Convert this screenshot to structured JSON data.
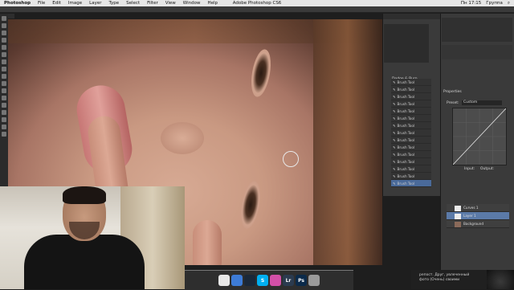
{
  "menubar": {
    "app_name": "Photoshop",
    "items": [
      "File",
      "Edit",
      "Image",
      "Layer",
      "Type",
      "Select",
      "Filter",
      "View",
      "Window",
      "Help"
    ],
    "clock": "Пн 17:15",
    "user": "Группа"
  },
  "window": {
    "title": "Adobe Photoshop CS6"
  },
  "layers_panel": {
    "group_label": "Dodge & Burn",
    "rows": [
      "Brush Tool",
      "Brush Tool",
      "Brush Tool",
      "Brush Tool",
      "Brush Tool",
      "Brush Tool",
      "Brush Tool",
      "Brush Tool",
      "Brush Tool",
      "Brush Tool",
      "Brush Tool",
      "Brush Tool",
      "Brush Tool",
      "Brush Tool",
      "Brush Tool"
    ]
  },
  "properties_panel": {
    "title": "Properties",
    "preset_label": "Preset:",
    "preset_value": "Custom",
    "channel_value": "RGB",
    "auto_label": "Auto",
    "input_label": "Input:",
    "output_label": "Output:"
  },
  "layers_right": {
    "rows": [
      "Curves 1",
      "Layer 1",
      "Background"
    ]
  },
  "dock": {
    "icons": [
      {
        "name": "chrome-icon",
        "label": "",
        "color": "#e8e8e8"
      },
      {
        "name": "finder-icon",
        "label": "",
        "color": "#3d7bd6"
      },
      {
        "name": "steam-icon",
        "label": "",
        "color": "#1b2838"
      },
      {
        "name": "skype-icon",
        "label": "S",
        "color": "#00aff0"
      },
      {
        "name": "itunes-icon",
        "label": "",
        "color": "#d24fa7"
      },
      {
        "name": "lightroom-icon",
        "label": "Lr",
        "color": "#2b3b4f"
      },
      {
        "name": "photoshop-icon",
        "label": "Ps",
        "color": "#0b2a4a"
      },
      {
        "name": "trash-icon",
        "label": "",
        "color": "#9a9a9a"
      }
    ]
  },
  "notification": {
    "text": "репост. Друг, увлеченный фото (Очень) своими"
  }
}
